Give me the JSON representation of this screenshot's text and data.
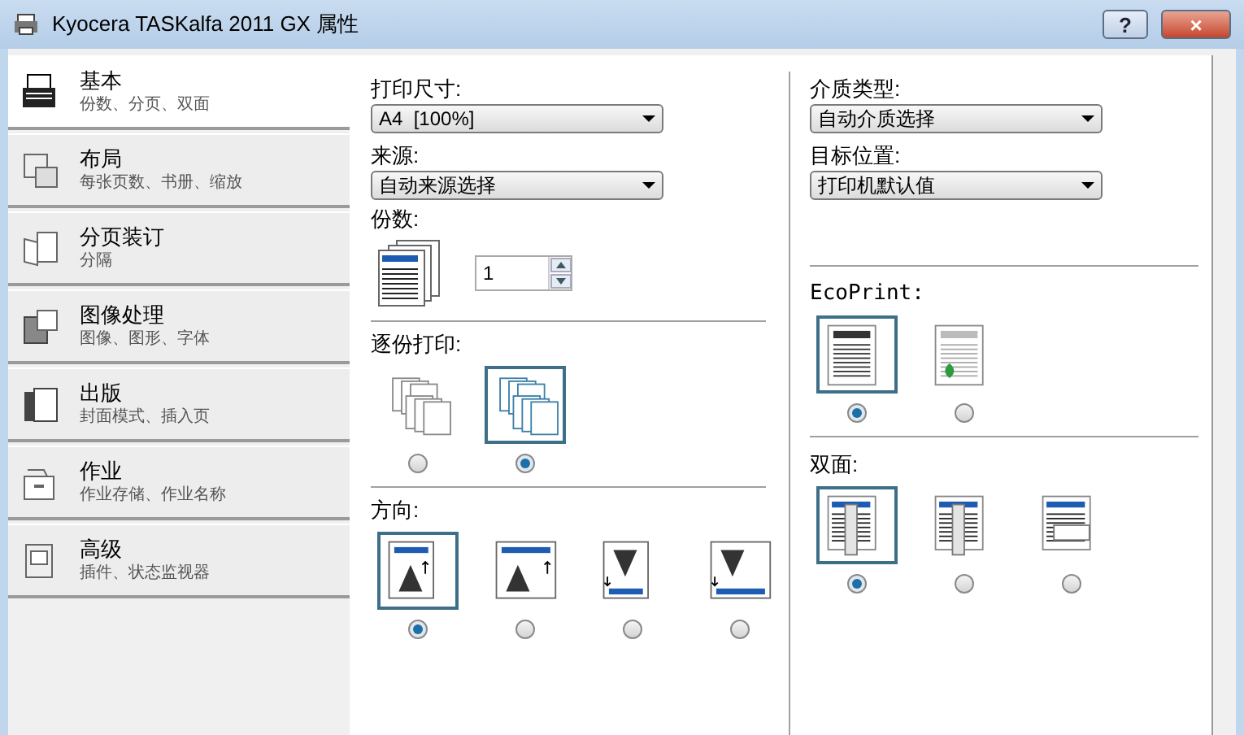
{
  "window": {
    "title": "Kyocera TASKalfa 2011 GX 属性",
    "buttons": [
      {
        "kind": "help",
        "label": "?"
      },
      {
        "kind": "close",
        "label": "×"
      }
    ]
  },
  "sidebar": {
    "items": [
      {
        "title": "基本",
        "subtitle": "份数、分页、双面",
        "selected": true
      },
      {
        "title": "布局",
        "subtitle": "每张页数、书册、缩放",
        "selected": false
      },
      {
        "title": "分页装订",
        "subtitle": "分隔",
        "selected": false
      },
      {
        "title": "图像处理",
        "subtitle": "图像、图形、字体",
        "selected": false
      },
      {
        "title": "出版",
        "subtitle": "封面模式、插入页",
        "selected": false
      },
      {
        "title": "作业",
        "subtitle": "作业存储、作业名称",
        "selected": false
      },
      {
        "title": "高级",
        "subtitle": "插件、状态监视器",
        "selected": false
      }
    ]
  },
  "left": {
    "print_size": {
      "label": "打印尺寸:",
      "value": "A4  [100%]"
    },
    "source": {
      "label": "来源:",
      "value": "自动来源选择"
    },
    "copies": {
      "label": "份数:",
      "value": "1"
    },
    "collate": {
      "label": "逐份打印:",
      "options": [
        {
          "kind": "uncollated",
          "selected": false
        },
        {
          "kind": "collated",
          "selected": true
        }
      ]
    },
    "orientation": {
      "label": "方向:",
      "options": [
        {
          "kind": "portrait",
          "selected": true
        },
        {
          "kind": "landscape",
          "selected": false
        },
        {
          "kind": "portrait_rotated",
          "selected": false
        },
        {
          "kind": "landscape_rotated",
          "selected": false
        }
      ]
    }
  },
  "right": {
    "media_type": {
      "label": "介质类型:",
      "value": "自动介质选择"
    },
    "destination": {
      "label": "目标位置:",
      "value": "打印机默认值"
    },
    "ecoprint": {
      "label": "EcoPrint:",
      "options": [
        {
          "kind": "eco_off",
          "selected": true
        },
        {
          "kind": "eco_on",
          "selected": false
        }
      ]
    },
    "duplex": {
      "label": "双面:",
      "options": [
        {
          "kind": "long_edge",
          "selected": true
        },
        {
          "kind": "short_edge",
          "selected": false
        },
        {
          "kind": "off",
          "selected": false
        }
      ]
    }
  }
}
